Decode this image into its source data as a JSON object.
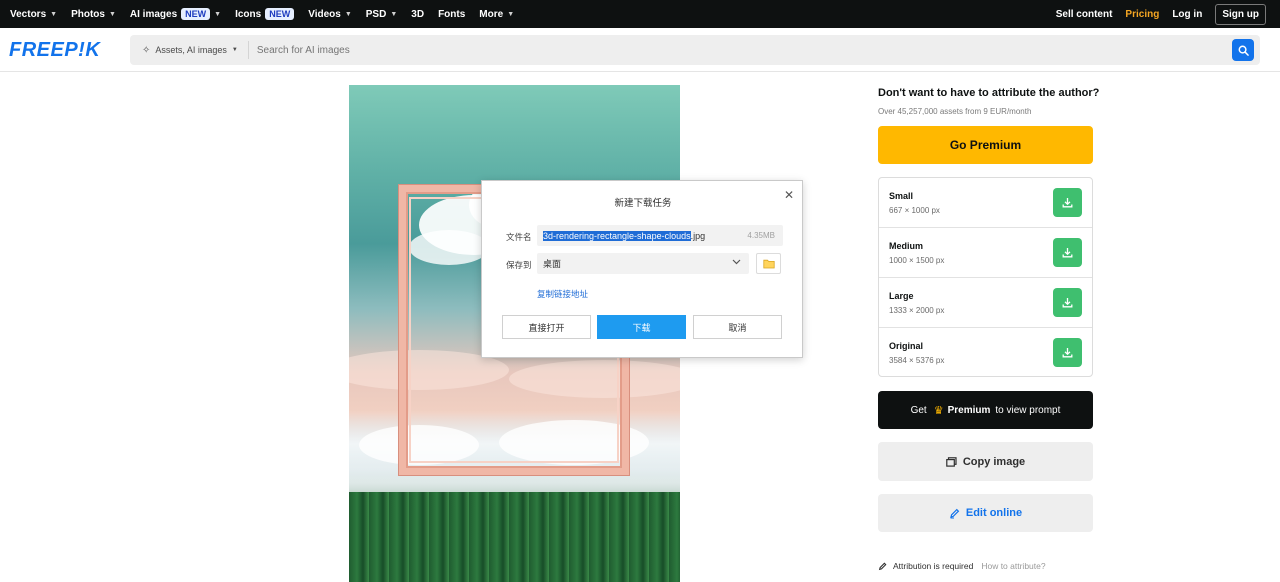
{
  "nav": {
    "items": [
      {
        "label": "Vectors",
        "chevron": true,
        "badge": ""
      },
      {
        "label": "Photos",
        "chevron": true,
        "badge": ""
      },
      {
        "label": "AI images",
        "chevron": true,
        "badge": "NEW"
      },
      {
        "label": "Icons",
        "chevron": false,
        "badge": "NEW"
      },
      {
        "label": "Videos",
        "chevron": true,
        "badge": ""
      },
      {
        "label": "PSD",
        "chevron": true,
        "badge": ""
      },
      {
        "label": "3D",
        "chevron": false,
        "badge": ""
      },
      {
        "label": "Fonts",
        "chevron": false,
        "badge": ""
      },
      {
        "label": "More",
        "chevron": true,
        "badge": ""
      }
    ],
    "sell_content": "Sell content",
    "pricing": "Pricing",
    "login": "Log in",
    "signup": "Sign up"
  },
  "brand": {
    "logo_text": "FREEP!K",
    "color": "#1273eb"
  },
  "search": {
    "scope_label": "Assets, AI images",
    "placeholder": "Search for AI images",
    "icon": "search-icon"
  },
  "panel": {
    "title": "Don't want to have to attribute the author?",
    "subtitle": "Over 45,257,000 assets from 9 EUR/month",
    "premium_button": "Go Premium",
    "premium_color": "#ffb800",
    "sizes": [
      {
        "name": "Small",
        "dims": "667 × 1000 px"
      },
      {
        "name": "Medium",
        "dims": "1000 × 1500 px"
      },
      {
        "name": "Large",
        "dims": "1333 × 2000 px"
      },
      {
        "name": "Original",
        "dims": "3584 × 5376 px"
      }
    ],
    "download_color": "#3fbf6f",
    "prompt_button": {
      "prefix": "Get",
      "bold": "Premium",
      "suffix": "to view prompt"
    },
    "copy_button": "Copy image",
    "edit_button": "Edit online",
    "attribution": "Attribution is required",
    "how_to_attribute": "How to attribute?"
  },
  "dialog": {
    "title": "新建下载任务",
    "filename_label": "文件名",
    "filename_selected": "3d-rendering-rectangle-shape-clouds",
    "filename_ext": ".jpg",
    "file_size": "4.35MB",
    "save_label": "保存到",
    "save_path": "桌面",
    "copy_link": "复制链接地址",
    "open_button": "直接打开",
    "download_button": "下载",
    "cancel_button": "取消",
    "primary_color": "#1e9bf0"
  }
}
